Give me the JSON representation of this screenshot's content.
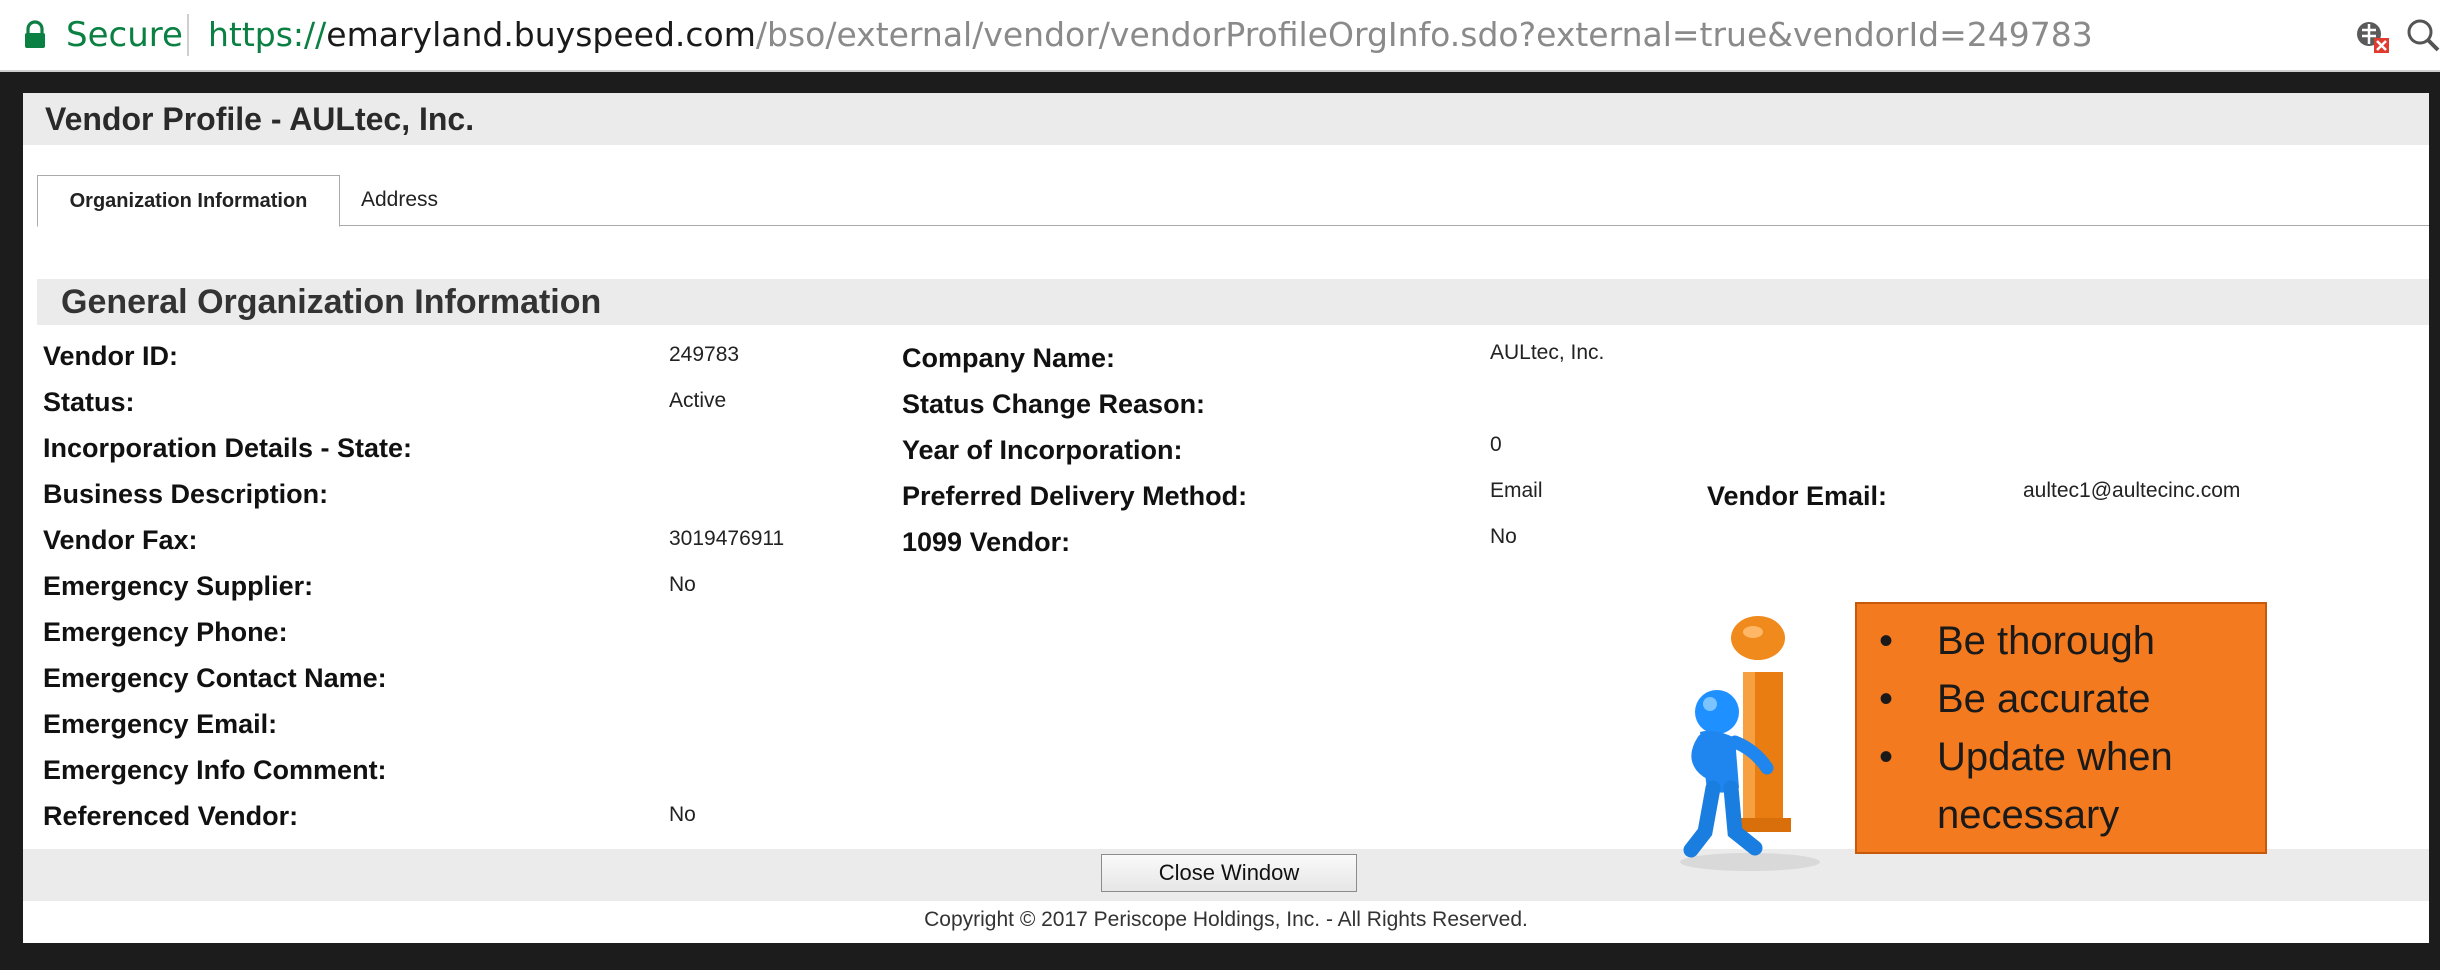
{
  "browser": {
    "secure_label": "Secure",
    "url_scheme": "https://",
    "url_host": "emaryland.buyspeed.com",
    "url_path": "/bso/external/vendor/vendorProfileOrgInfo.sdo?external=true&vendorId=249783",
    "icons": [
      "lock-icon",
      "extension-blocked-icon",
      "zoom-icon"
    ]
  },
  "window": {
    "title": "Vendor Profile - AULtec, Inc.",
    "tabs": [
      {
        "label": "Organization Information",
        "active": true
      },
      {
        "label": "Address",
        "active": false
      }
    ],
    "section_title": "General Organization Information"
  },
  "fields": {
    "vendor_id": {
      "label": "Vendor ID:",
      "value": "249783"
    },
    "status": {
      "label": "Status:",
      "value": "Active"
    },
    "incorporation_state": {
      "label": "Incorporation Details - State:",
      "value": ""
    },
    "business_description": {
      "label": "Business Description:",
      "value": ""
    },
    "vendor_fax": {
      "label": "Vendor Fax:",
      "value": "3019476911"
    },
    "emergency_supplier": {
      "label": "Emergency Supplier:",
      "value": "No"
    },
    "emergency_phone": {
      "label": "Emergency Phone:",
      "value": ""
    },
    "emergency_contact_name": {
      "label": "Emergency Contact Name:",
      "value": ""
    },
    "emergency_email": {
      "label": "Emergency Email:",
      "value": ""
    },
    "emergency_info_comment": {
      "label": "Emergency Info Comment:",
      "value": ""
    },
    "referenced_vendor": {
      "label": "Referenced Vendor:",
      "value": "No"
    },
    "company_name": {
      "label": "Company Name:",
      "value": "AULtec, Inc."
    },
    "status_change_reason": {
      "label": "Status Change Reason:",
      "value": ""
    },
    "year_of_incorporation": {
      "label": "Year of Incorporation:",
      "value": "0"
    },
    "preferred_delivery_method": {
      "label": "Preferred Delivery Method:",
      "value": "Email"
    },
    "vendor_1099": {
      "label": "1099 Vendor:",
      "value": "No"
    },
    "vendor_email": {
      "label": "Vendor Email:",
      "value": "aultec1@aultecinc.com"
    }
  },
  "footer": {
    "close_label": "Close Window",
    "copyright": "Copyright © 2017 Periscope Holdings, Inc. - All Rights Reserved."
  },
  "callout": {
    "items": [
      "Be thorough",
      "Be accurate",
      "Update when",
      "necessary"
    ],
    "bullet_char": "•",
    "background": "#f47a1f",
    "figure_icon": "info-person-icon"
  },
  "colors": {
    "secure_green": "#0b8043",
    "panel_gray": "#ebebeb",
    "figure_blue": "#1e90ff",
    "figure_orange": "#f08a1c"
  }
}
